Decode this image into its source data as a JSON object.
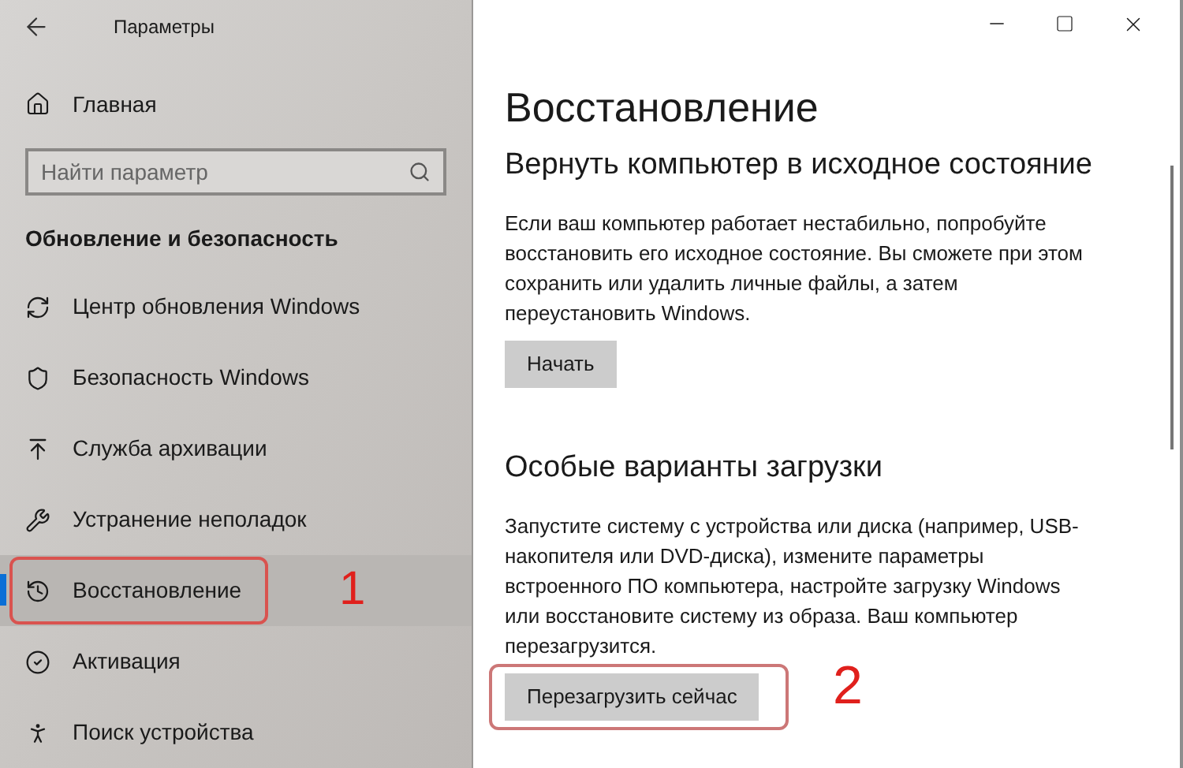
{
  "window": {
    "title": "Параметры"
  },
  "sidebar": {
    "home": "Главная",
    "search": {
      "placeholder": "Найти параметр"
    },
    "section": "Обновление и безопасность",
    "items": [
      {
        "label": "Центр обновления Windows",
        "selected": false
      },
      {
        "label": "Безопасность Windows",
        "selected": false
      },
      {
        "label": "Служба архивации",
        "selected": false
      },
      {
        "label": "Устранение неполадок",
        "selected": false
      },
      {
        "label": "Восстановление",
        "selected": true,
        "marker": "1"
      },
      {
        "label": "Активация",
        "selected": false
      },
      {
        "label": "Поиск устройства",
        "selected": false
      }
    ]
  },
  "page": {
    "title": "Восстановление",
    "sections": [
      {
        "heading": "Вернуть компьютер в исходное состояние",
        "text": "Если ваш компьютер работает нестабильно, попробуйте восстановить его исходное состояние. Вы сможете при этом сохранить или удалить личные файлы, а затем переустановить Windows.",
        "button": "Начать"
      },
      {
        "heading": "Особые варианты загрузки",
        "text": "Запустите систему с устройства или диска (например, USB-накопителя или DVD-диска), измените параметры встроенного ПО компьютера, настройте загрузку Windows или восстановите систему из образа. Ваш компьютер перезагрузится.",
        "button": "Перезагрузить сейчас",
        "marker": "2"
      }
    ]
  }
}
